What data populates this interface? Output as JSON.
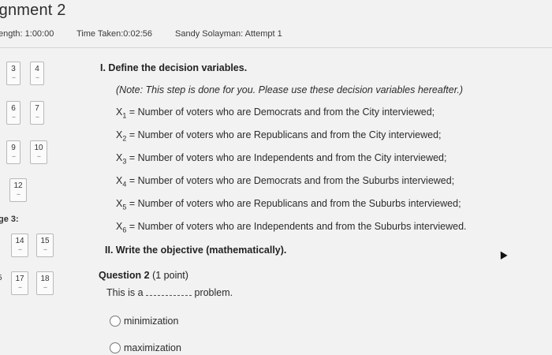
{
  "header": {
    "title": "ignment 2",
    "length": "ength: 1:00:00",
    "time_taken": "Time Taken:0:02:56",
    "attempt": "Sandy Solayman: Attempt 1"
  },
  "nav": {
    "tiles": [
      {
        "num": "3",
        "dash": "--"
      },
      {
        "num": "4",
        "dash": "--"
      },
      {
        "num": "6",
        "dash": "--"
      },
      {
        "num": "7",
        "dash": "--"
      },
      {
        "num": "9",
        "dash": "--"
      },
      {
        "num": "10",
        "dash": "--"
      },
      {
        "num": "12",
        "dash": "--"
      },
      {
        "num": "14",
        "dash": "--"
      },
      {
        "num": "15",
        "dash": "--"
      },
      {
        "num": "17",
        "dash": "--"
      },
      {
        "num": "18",
        "dash": "--"
      }
    ],
    "page_label": "ge 3:",
    "side_num": "5"
  },
  "content": {
    "heading1": "I. Define the decision variables.",
    "note": "(Note: This step is done for you. Please use these decision variables hereafter.)",
    "definitions": [
      {
        "var": "X",
        "sub": "1",
        "text": " = Number of voters who are Democrats and from the City interviewed;"
      },
      {
        "var": "X",
        "sub": "2",
        "text": " = Number of voters who are Republicans and from the City interviewed;"
      },
      {
        "var": "X",
        "sub": "3",
        "text": " = Number of voters who are Independents and from the City interviewed;"
      },
      {
        "var": "X",
        "sub": "4",
        "text": " = Number of voters who are Democrats and from the Suburbs interviewed;"
      },
      {
        "var": "X",
        "sub": "5",
        "text": " = Number of voters who are Republicans and from the Suburbs interviewed;"
      },
      {
        "var": "X",
        "sub": "6",
        "text": " = Number of voters who are Independents and from the Suburbs interviewed."
      }
    ],
    "heading2": "II. Write the objective (mathematically)."
  },
  "question": {
    "label": "Question 2",
    "points": "(1 point)",
    "text_before": "This is a ",
    "text_after": " problem.",
    "options": [
      "minimization",
      "maximization"
    ]
  }
}
